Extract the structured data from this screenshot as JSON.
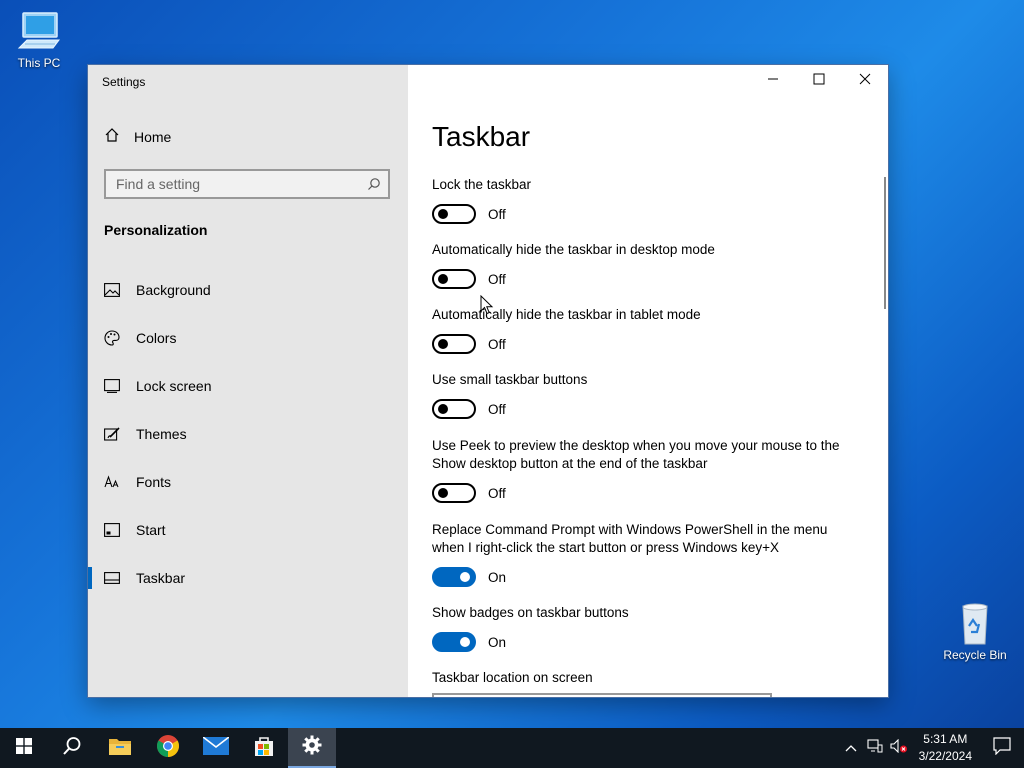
{
  "desktop": {
    "icons": [
      {
        "label": "This PC"
      },
      {
        "label": "Recycle Bin"
      }
    ]
  },
  "window": {
    "title": "Settings",
    "controls": [
      "minimize-icon",
      "maximize-icon",
      "close-icon"
    ]
  },
  "sidebar": {
    "home_label": "Home",
    "search_placeholder": "Find a setting",
    "section": "Personalization",
    "items": [
      {
        "label": "Background",
        "icon": "picture-icon"
      },
      {
        "label": "Colors",
        "icon": "palette-icon"
      },
      {
        "label": "Lock screen",
        "icon": "lock-screen-icon"
      },
      {
        "label": "Themes",
        "icon": "brush-icon"
      },
      {
        "label": "Fonts",
        "icon": "font-icon"
      },
      {
        "label": "Start",
        "icon": "start-icon"
      },
      {
        "label": "Taskbar",
        "icon": "taskbar-icon",
        "active": true
      }
    ]
  },
  "content": {
    "title": "Taskbar",
    "settings": [
      {
        "label": "Lock the taskbar",
        "state": "Off",
        "on": false
      },
      {
        "label": "Automatically hide the taskbar in desktop mode",
        "state": "Off",
        "on": false
      },
      {
        "label": "Automatically hide the taskbar in tablet mode",
        "state": "Off",
        "on": false
      },
      {
        "label": "Use small taskbar buttons",
        "state": "Off",
        "on": false
      },
      {
        "label": "Use Peek to preview the desktop when you move your mouse to the Show desktop button at the end of the taskbar",
        "state": "Off",
        "on": false
      },
      {
        "label": "Replace Command Prompt with Windows PowerShell in the menu when I right-click the start button or press Windows key+X",
        "state": "On",
        "on": true
      },
      {
        "label": "Show badges on taskbar buttons",
        "state": "On",
        "on": true
      }
    ],
    "location_label": "Taskbar location on screen"
  },
  "taskbar": {
    "apps": [
      "start-icon",
      "search-icon",
      "file-explorer-icon",
      "chrome-icon",
      "mail-icon",
      "store-icon",
      "settings-icon"
    ],
    "active_app": "settings-icon",
    "time": "5:31 AM",
    "date": "3/22/2024"
  },
  "colors": {
    "accent": "#0067c0",
    "sidebar_bg": "#e6e6e6",
    "taskbar_bg": "#101820"
  }
}
